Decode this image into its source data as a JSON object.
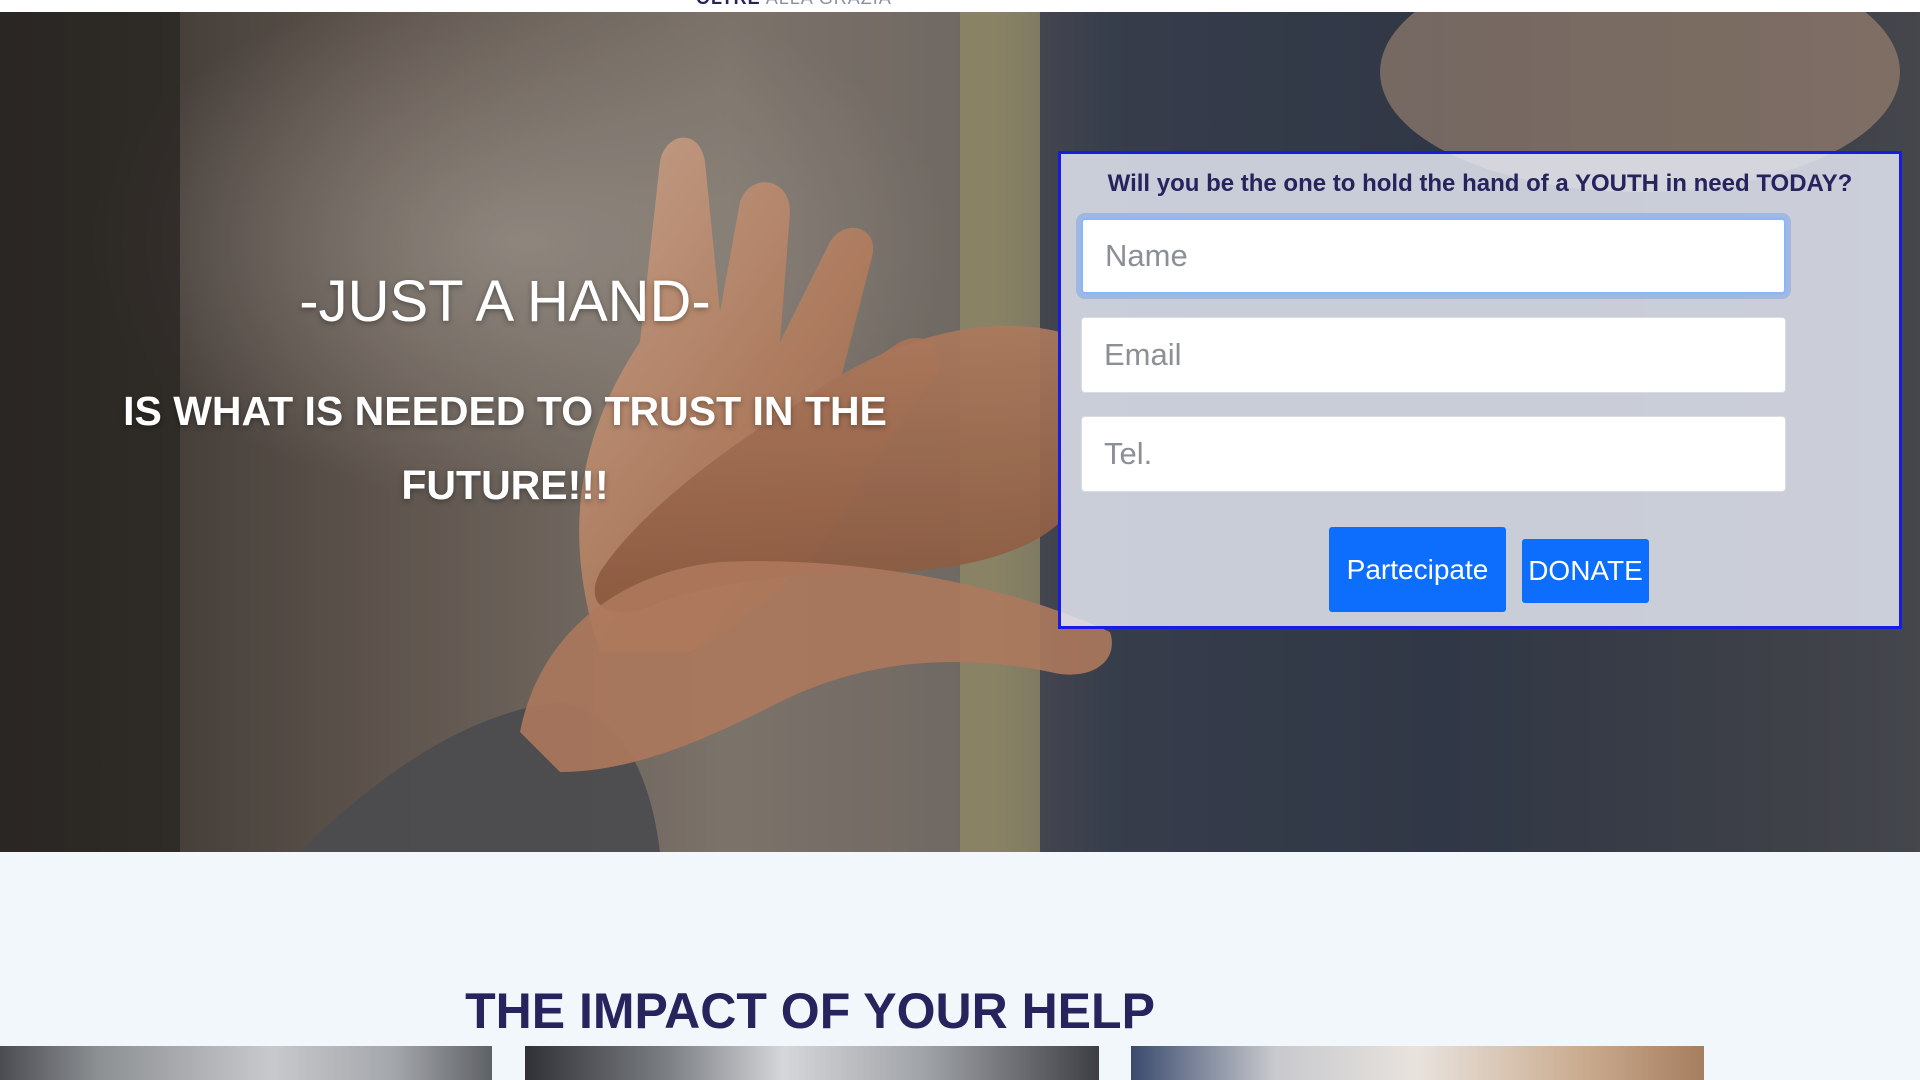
{
  "header": {
    "logo_strong": "OLTRE",
    "logo_light": "ALLA GRAZIA"
  },
  "hero": {
    "title": "-JUST A HAND-",
    "subtitle": "IS WHAT IS NEEDED TO TRUST IN THE FUTURE!!!",
    "background_image": "reaching-hands-photo"
  },
  "form": {
    "question": "Will you be the one to hold the hand of a YOUTH in need TODAY?",
    "name_placeholder": "Name",
    "name_value": "",
    "email_placeholder": "Email",
    "email_value": "",
    "tel_placeholder": "Tel.",
    "tel_value": "",
    "participate_label": "Partecipate",
    "donate_label": "DONATE"
  },
  "impact": {
    "title": "THE IMPACT OF YOUR HELP",
    "images": [
      "impact-photo-1",
      "impact-photo-2",
      "impact-photo-3"
    ]
  },
  "colors": {
    "navy": "#26235d",
    "button_blue": "#0d6efd",
    "panel_border": "#1a1ae6",
    "section_bg": "#f2f7fc"
  }
}
